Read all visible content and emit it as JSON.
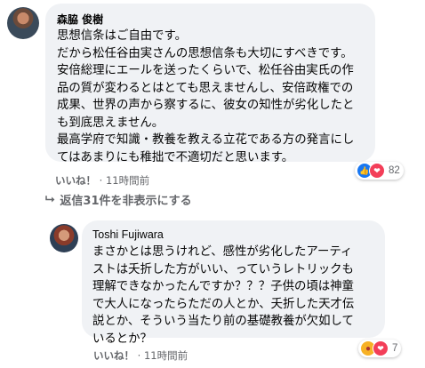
{
  "comment1": {
    "author": "森脇 俊樹",
    "lines": [
      "思想信条はご自由です。",
      "だから松任谷由実さんの思想信条も大切にすべきです。",
      "安倍総理にエールを送ったくらいで、松任谷由実氏の作",
      "品の質が変わるとはとても思えませんし、安倍政権での",
      "成果、世界の声から察するに、彼女の知性が劣化したと",
      "も到底思えません。",
      "最高学府で知識・教養を教える立花である方の発言にし",
      "てはあまりにも稚拙で不適切だと思います。"
    ],
    "reaction_count": "82",
    "like_label": "いいね！",
    "separator": "·",
    "time": "11時間前",
    "icons": [
      "like-icon",
      "love-icon"
    ]
  },
  "replies_toggle": {
    "label": "返信31件を非表示にする",
    "icon": "reply-arrow-icon"
  },
  "comment2": {
    "author": "Toshi Fujiwara",
    "lines": [
      "まさかとは思うけれど、感性が劣化したアーティ",
      "ストは夭折した方がいい、っていうレトリックも",
      "理解できなかったんですか？？？子供の頃は神童",
      "で大人になったらただの人とか、夭折した天才伝",
      "説とか、そういう当たり前の基礎教養が欠如して",
      "いるとか？"
    ],
    "reaction_count": "7",
    "like_label": "いいね！",
    "separator": "·",
    "time": "11時間前",
    "icons": [
      "angry-icon",
      "love-icon"
    ]
  },
  "colors": {
    "bubble": "#f0f2f5",
    "secondary_text": "#65676b",
    "like_blue": "#1877f2",
    "love_red": "#f33e58",
    "angry_orange": "#f7b125"
  }
}
